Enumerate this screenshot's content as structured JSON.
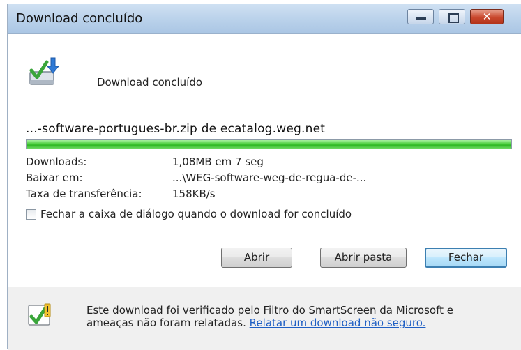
{
  "window": {
    "title": "Download concluído",
    "controls": {
      "minimize": "minimize",
      "maximize": "maximize",
      "close": "✕"
    }
  },
  "header": {
    "status": "Download concluído",
    "icon": "download-complete-icon"
  },
  "file": {
    "description": "...-software-portugues-br.zip de ecatalog.weg.net"
  },
  "progress": {
    "percent": 100,
    "color": "#2fb824"
  },
  "details": [
    {
      "label": "Downloads:",
      "value": "1,08MB em 7 seg"
    },
    {
      "label": "Baixar em:",
      "value": "...\\WEG-software-weg-de-regua-de-..."
    },
    {
      "label": "Taxa de transferência:",
      "value": "158KB/s"
    }
  ],
  "checkbox": {
    "label": "Fechar a caixa de diálogo quando o download for concluído",
    "checked": false
  },
  "buttons": {
    "open": "Abrir",
    "open_folder": "Abrir pasta",
    "close": "Fechar"
  },
  "footer": {
    "text": "Este download foi verificado pelo Filtro do SmartScreen da Microsoft e",
    "text2": "ameaças não foram relatadas.",
    "link": "Relatar um download não seguro.",
    "icon": "smartscreen-shield-icon",
    "link_color": "#1f5fc4"
  }
}
